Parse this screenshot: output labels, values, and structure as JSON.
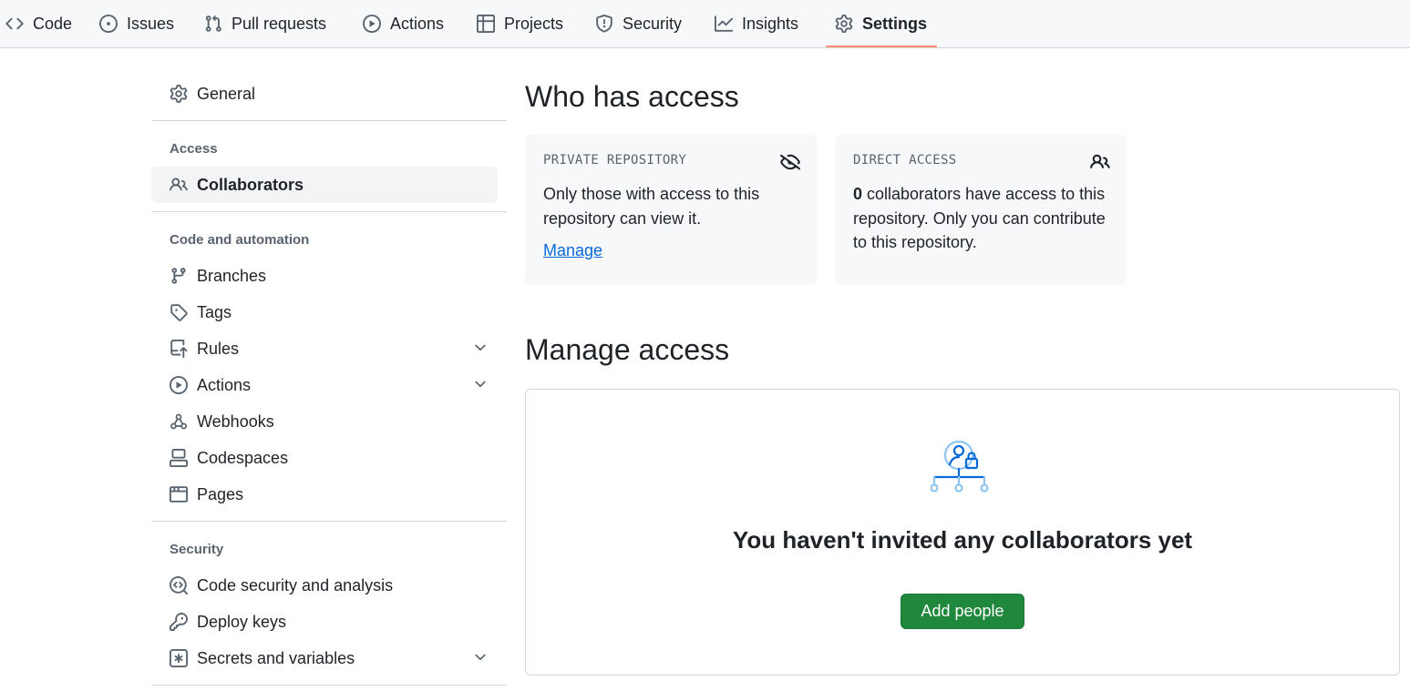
{
  "nav": {
    "tabs": [
      {
        "label": "Code",
        "icon": "code-icon"
      },
      {
        "label": "Issues",
        "icon": "issue-opened-icon"
      },
      {
        "label": "Pull requests",
        "icon": "git-pull-request-icon"
      },
      {
        "label": "Actions",
        "icon": "play-icon"
      },
      {
        "label": "Projects",
        "icon": "table-icon"
      },
      {
        "label": "Security",
        "icon": "shield-icon"
      },
      {
        "label": "Insights",
        "icon": "graph-icon"
      },
      {
        "label": "Settings",
        "icon": "gear-icon",
        "active": true
      }
    ],
    "accent_color": "#fd8c73"
  },
  "sidebar": {
    "general": "General",
    "sections": [
      {
        "heading": "Access",
        "items": [
          "Collaborators"
        ]
      },
      {
        "heading": "Code and automation",
        "items": [
          "Branches",
          "Tags",
          "Rules",
          "Actions",
          "Webhooks",
          "Codespaces",
          "Pages"
        ]
      },
      {
        "heading": "Security",
        "items": [
          "Code security and analysis",
          "Deploy keys",
          "Secrets and variables"
        ]
      }
    ],
    "selected": "Collaborators",
    "selected_color": "#0969da"
  },
  "main": {
    "who_title": "Who has access",
    "private_card": {
      "label": "PRIVATE REPOSITORY",
      "text": "Only those with access to this repository can view it.",
      "link": "Manage"
    },
    "direct_card": {
      "label": "DIRECT ACCESS",
      "count": "0",
      "text": " collaborators have access to this repository. Only you can contribute to this repository."
    },
    "manage_title": "Manage access",
    "empty_title": "You haven't invited any collaborators yet",
    "add_button": "Add people",
    "button_color": "#1f883d"
  }
}
